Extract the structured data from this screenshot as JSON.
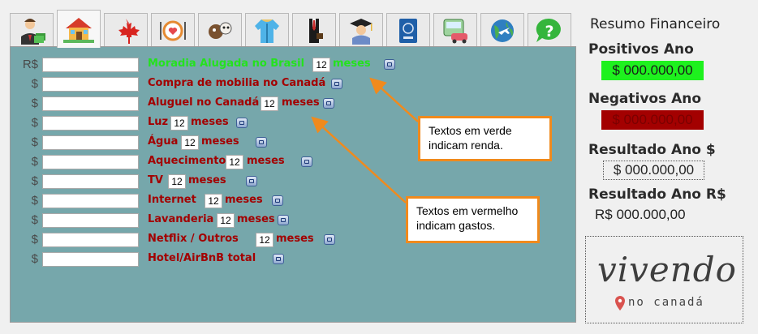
{
  "tabs": [
    {
      "icon": "person-money-icon",
      "active": false
    },
    {
      "icon": "house-icon",
      "active": true
    },
    {
      "icon": "maple-leaf-icon",
      "active": false
    },
    {
      "icon": "plate-cutlery-icon",
      "active": false
    },
    {
      "icon": "pets-icon",
      "active": false
    },
    {
      "icon": "winter-coat-icon",
      "active": false
    },
    {
      "icon": "business-suit-icon",
      "active": false
    },
    {
      "icon": "graduate-icon",
      "active": false
    },
    {
      "icon": "passport-icon",
      "active": false
    },
    {
      "icon": "bus-car-icon",
      "active": false
    },
    {
      "icon": "globe-plane-icon",
      "active": false
    },
    {
      "icon": "help-icon",
      "active": false
    }
  ],
  "rows": [
    {
      "currency": "R$",
      "label": "Moradia Alugada no Brasil",
      "months": "12",
      "suffix": "meses",
      "type": "income"
    },
    {
      "currency": "$",
      "label": "Compra de mobilia no Canadá",
      "type": "expense"
    },
    {
      "currency": "$",
      "label": "Aluguel no Canadá",
      "months": "12",
      "suffix": "meses",
      "type": "expense"
    },
    {
      "currency": "$",
      "label": "Luz",
      "months": "12",
      "suffix": "meses",
      "type": "expense"
    },
    {
      "currency": "$",
      "label": "Água",
      "months": "12",
      "suffix": "meses",
      "type": "expense"
    },
    {
      "currency": "$",
      "label": "Aquecimento",
      "months": "12",
      "suffix": "meses",
      "type": "expense"
    },
    {
      "currency": "$",
      "label": "TV",
      "months": "12",
      "suffix": "meses",
      "type": "expense"
    },
    {
      "currency": "$",
      "label": "Internet",
      "months": "12",
      "suffix": "meses",
      "type": "expense"
    },
    {
      "currency": "$",
      "label": "Lavanderia",
      "months": "12",
      "suffix": "meses",
      "type": "expense"
    },
    {
      "currency": "$",
      "label": "Netflix / Outros",
      "months": "12",
      "suffix": "meses",
      "type": "expense"
    },
    {
      "currency": "$",
      "label": "Hotel/AirBnB total",
      "type": "expense"
    }
  ],
  "callouts": {
    "green": "Textos em verde indicam renda.",
    "red": "Textos em vermelho indicam gastos."
  },
  "summary": {
    "title": "Resumo Financeiro",
    "positive_label": "Positivos Ano",
    "positive_value": "$ 000.000,00",
    "negative_label": "Negativos Ano",
    "negative_value": "$ 000.000,00",
    "result_usd_label": "Resultado Ano $",
    "result_usd_value": "$ 000.000,00",
    "result_brl_label": "Resultado Ano R$",
    "result_brl_value": "R$ 000.000,00"
  },
  "logo": {
    "word": "vivendo",
    "sub": "no canadá"
  },
  "colors": {
    "panel": "#76a7ab",
    "income": "#24e21e",
    "expense": "#a30000",
    "positive_bg": "#1ef11e",
    "negative_bg": "#a30000",
    "callout_border": "#f08a1d"
  }
}
